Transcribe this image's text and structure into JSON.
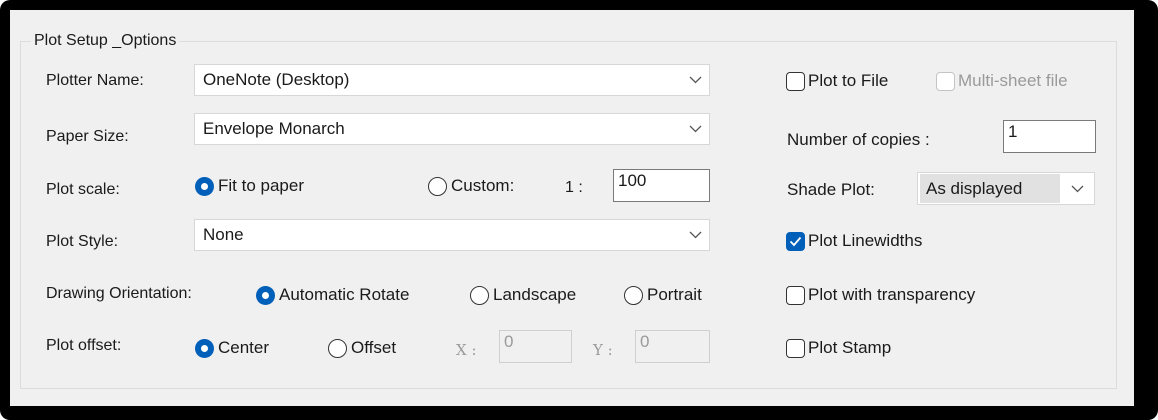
{
  "group": {
    "title": "Plot Setup _Options"
  },
  "plotter": {
    "label": "Plotter Name:",
    "value": "OneNote (Desktop)"
  },
  "paper": {
    "label": "Paper Size:",
    "value": "Envelope Monarch"
  },
  "scale": {
    "label": "Plot scale:",
    "fit": "Fit to paper",
    "custom": "Custom:",
    "ratio_prefix": "1 :",
    "value": "100",
    "selected": "fit"
  },
  "style": {
    "label": "Plot Style:",
    "value": "None"
  },
  "orientation": {
    "label": "Drawing Orientation:",
    "options": [
      "Automatic Rotate",
      "Landscape",
      "Portrait"
    ],
    "selected": "Automatic Rotate"
  },
  "offset": {
    "label": "Plot offset:",
    "center": "Center",
    "offset": "Offset",
    "x_label": "X :",
    "x_value": "0",
    "y_label": "Y :",
    "y_value": "0",
    "selected": "Center"
  },
  "right": {
    "plot_to_file": {
      "label": "Plot to File",
      "checked": false
    },
    "multi_sheet": {
      "label": "Multi-sheet file",
      "checked": false,
      "enabled": false
    },
    "copies": {
      "label": "Number of copies :",
      "value": "1"
    },
    "shade": {
      "label": "Shade Plot:",
      "value": "As displayed"
    },
    "linewidths": {
      "label": "Plot Linewidths",
      "checked": true
    },
    "transparency": {
      "label": "Plot with transparency",
      "checked": false
    },
    "stamp": {
      "label": "Plot Stamp",
      "checked": false
    }
  },
  "colors": {
    "accent": "#005fb8",
    "panel": "#f0f0f0"
  }
}
